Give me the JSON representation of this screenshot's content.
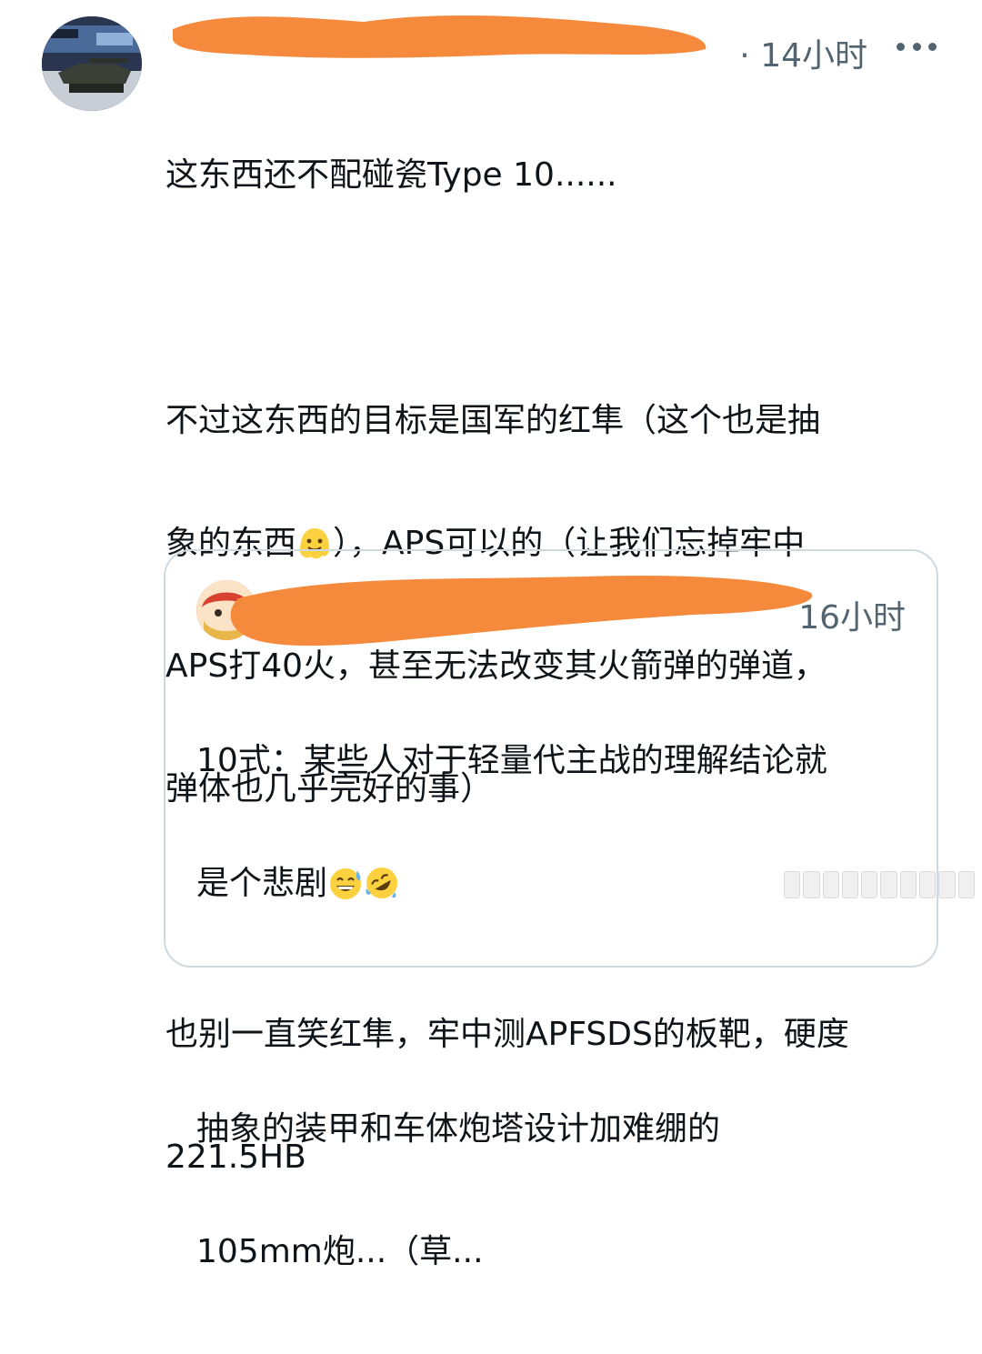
{
  "post": {
    "timestamp": "14小时",
    "time_separator": "·",
    "more_icon": "more-horizontal-icon",
    "body_lines": [
      "这东西还不配碰瓷Type 10......",
      "",
      "不过这东西的目标是国军的红隼（这个也是抽",
      "象的东西",
      "），APS可以的（让我们忘掉牢中",
      "APS打40火，甚至无法改变其火箭弹的弹道，",
      "弹体也几乎完好的事）",
      "",
      "也别一直笑红隼，牢中测APFSDS的板靶，硬度",
      "221.5HB"
    ],
    "emoji_melting": "melting-face-emoji"
  },
  "quoted_post": {
    "timestamp": "16小时",
    "line1": "10式：某些人对于轻量代主战的理解结论就",
    "line2": "是个悲剧",
    "line3": "",
    "line4": "抽象的装甲和车体炮塔设计加难绷的",
    "line5": "105mm炮...（草...",
    "emojis": [
      "grinning-sweat-emoji",
      "rolling-laughing-emoji"
    ]
  },
  "colors": {
    "redaction": "#f5893c",
    "secondary_text": "#536471",
    "border": "#cfd9de"
  }
}
